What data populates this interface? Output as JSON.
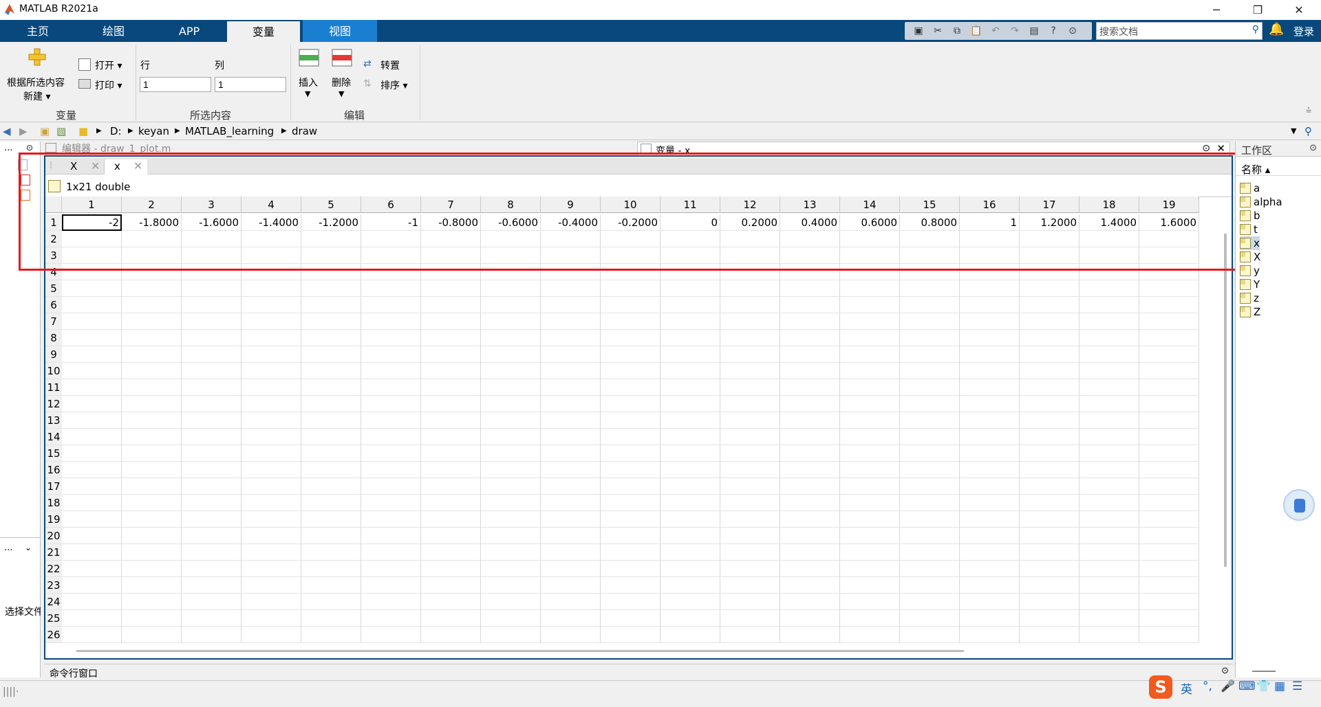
{
  "window": {
    "title": "MATLAB R2021a",
    "minimize": "─",
    "restore": "❐",
    "close": "✕"
  },
  "ribbon_tabs": [
    "主页",
    "绘图",
    "APP",
    "变量",
    "视图"
  ],
  "header": {
    "search_placeholder": "搜索文档",
    "login": "登录"
  },
  "ribbon": {
    "new_from_selection": "根据所选内容",
    "new": "新建 ▾",
    "open": "打开 ▾",
    "print": "打印 ▾",
    "row_label": "行",
    "col_label": "列",
    "row_value": "1",
    "col_value": "1",
    "insert": "插入",
    "delete": "删除",
    "transpose": "转置",
    "sort": "排序 ▾",
    "section_variable": "变量",
    "section_selection": "所选内容",
    "section_edit": "编辑"
  },
  "address": {
    "drive": "D:",
    "parts": [
      "keyan",
      "MATLAB_learning",
      "draw"
    ]
  },
  "editor_header": "编辑器 - draw_1_plot.m",
  "variable_header": "变量 - x",
  "variable_editor": {
    "tabs": [
      {
        "label": "X"
      },
      {
        "label": "x"
      }
    ],
    "info": "1x21 double",
    "columns": [
      "1",
      "2",
      "3",
      "4",
      "5",
      "6",
      "7",
      "8",
      "9",
      "10",
      "11",
      "12",
      "13",
      "14",
      "15",
      "16",
      "17",
      "18",
      "19"
    ],
    "rows": [
      "1",
      "2",
      "3",
      "4",
      "5",
      "6",
      "7",
      "8",
      "9",
      "10",
      "11",
      "12",
      "13",
      "14",
      "15",
      "16",
      "17",
      "18",
      "19",
      "20",
      "21",
      "22",
      "23",
      "24",
      "25",
      "26"
    ],
    "row1_values": [
      "-2",
      "-1.8000",
      "-1.6000",
      "-1.4000",
      "-1.2000",
      "-1",
      "-0.8000",
      "-0.6000",
      "-0.4000",
      "-0.2000",
      "0",
      "0.2000",
      "0.4000",
      "0.6000",
      "0.8000",
      "1",
      "1.2000",
      "1.4000",
      "1.6000"
    ]
  },
  "left_panel": {
    "top_label": "...",
    "bottom_label": "...",
    "select_file": "选择文件"
  },
  "workspace": {
    "title": "工作区",
    "name_column": "名称 ▴",
    "items": [
      "a",
      "alpha",
      "b",
      "t",
      "x",
      "X",
      "y",
      "Y",
      "z",
      "Z"
    ],
    "selected": "x"
  },
  "command_window": "命令行窗口",
  "ime": {
    "logo": "S",
    "lang": "英"
  },
  "colors": {
    "tab_bar": "#08487c",
    "view_tab": "#1b7fd1",
    "highlight_box": "#e8171e"
  }
}
